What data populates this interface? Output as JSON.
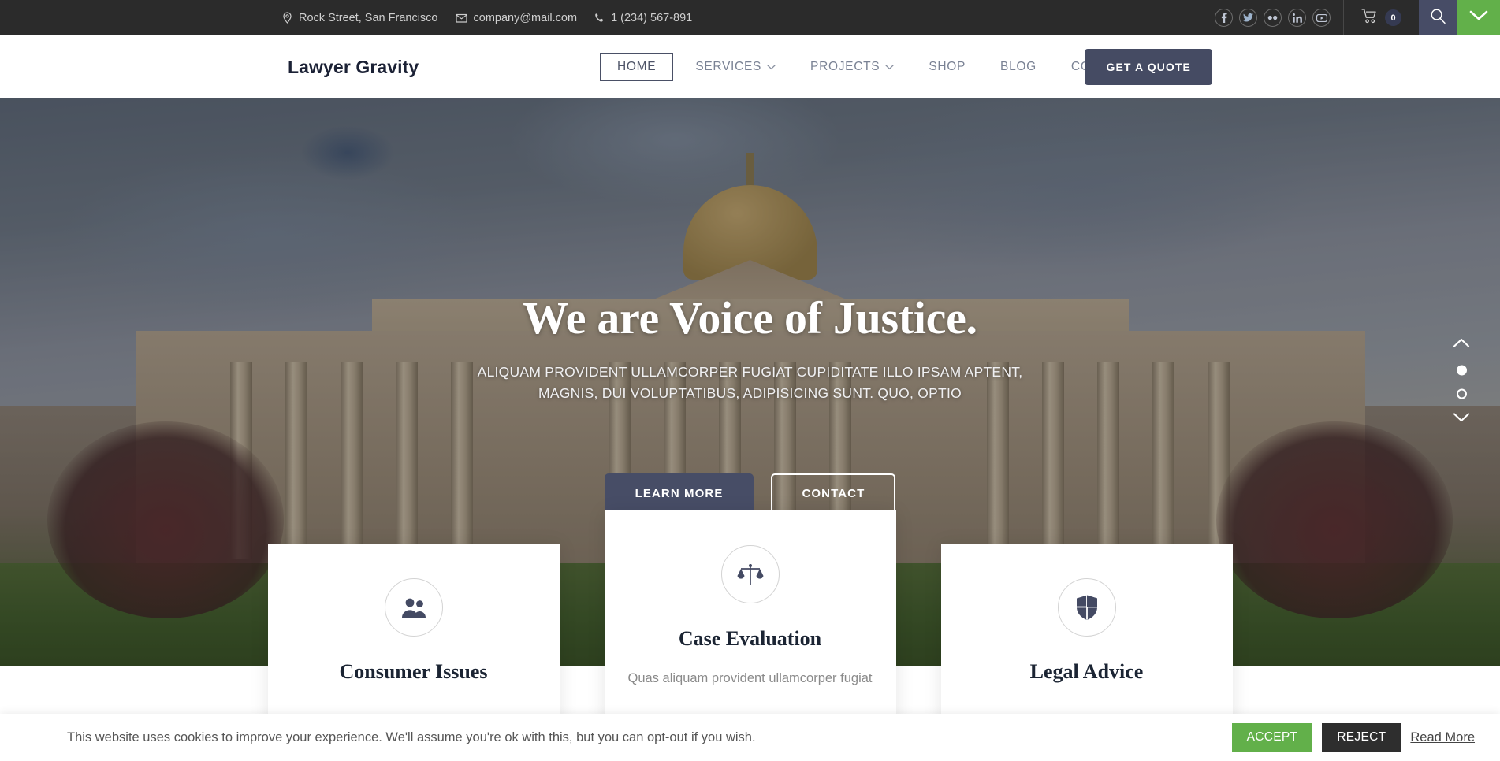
{
  "topbar": {
    "address": "Rock Street, San Francisco",
    "email": "company@mail.com",
    "phone": "1 (234) 567-891",
    "address_icon": "map-pin-icon",
    "email_icon": "envelope-icon",
    "phone_icon": "phone-icon",
    "social": [
      {
        "name": "facebook",
        "glyph": "f"
      },
      {
        "name": "twitter",
        "glyph": "t"
      },
      {
        "name": "flickr",
        "glyph": "··"
      },
      {
        "name": "linkedin",
        "glyph": "in"
      },
      {
        "name": "youtube",
        "glyph": "▶"
      }
    ],
    "cart_icon": "shopping-cart-icon",
    "cart_count": "0",
    "search_icon": "search-icon",
    "collapse_icon": "chevron-down-icon",
    "bg_color": "#2b2b2b",
    "search_bg": "#474c66",
    "green_tab_color": "#62b04a"
  },
  "header": {
    "logo": "Lawyer Gravity",
    "nav": [
      {
        "label": "HOME",
        "active": true,
        "has_dropdown": false
      },
      {
        "label": "SERVICES",
        "active": false,
        "has_dropdown": true
      },
      {
        "label": "PROJECTS",
        "active": false,
        "has_dropdown": true
      },
      {
        "label": "SHOP",
        "active": false,
        "has_dropdown": false
      },
      {
        "label": "BLOG",
        "active": false,
        "has_dropdown": false
      },
      {
        "label": "CONTACT",
        "active": false,
        "has_dropdown": false
      }
    ],
    "quote_label": "GET A QUOTE",
    "quote_bg": "#454b63"
  },
  "hero": {
    "title": "We are Voice of Justice.",
    "subtitle": "ALIQUAM PROVIDENT ULLAMCORPER FUGIAT CUPIDITATE ILLO IPSAM APTENT, MAGNIS, DUI VOLUPTATIBUS, ADIPISICING SUNT. QUO, OPTIO",
    "primary_label": "LEARN MORE",
    "secondary_label": "CONTACT",
    "slider": {
      "up_icon": "chevron-up-icon",
      "down_icon": "chevron-down-icon",
      "slides": 2,
      "active_slide": 1
    }
  },
  "cards": [
    {
      "icon": "users-icon",
      "title": "Consumer Issues",
      "text": "",
      "raised": false
    },
    {
      "icon": "scales-of-justice-icon",
      "title": "Case Evaluation",
      "text": "Quas aliquam provident ullamcorper fugiat",
      "raised": true
    },
    {
      "icon": "shield-icon",
      "title": "Legal Advice",
      "text": "",
      "raised": false
    }
  ],
  "cookie": {
    "message": "This website uses cookies to improve your experience. We'll assume you're ok with this, but you can opt-out if you wish.",
    "accept_label": "ACCEPT",
    "reject_label": "REJECT",
    "read_more_label": "Read More",
    "accept_color": "#62b04a",
    "reject_color": "#2e2e2e"
  }
}
